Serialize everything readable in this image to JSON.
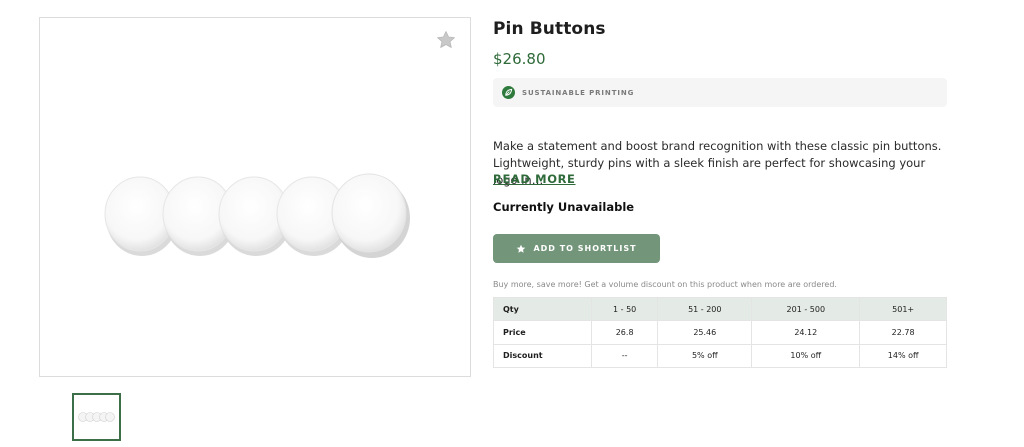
{
  "product": {
    "title": "Pin Buttons",
    "price": "$26.80",
    "badge": "SUSTAINABLE PRINTING",
    "description": "Make a statement and boost brand recognition with these classic pin buttons. Lightweight, sturdy pins with a sleek finish are perfect for showcasing your logo in…",
    "read_more": "READ MORE",
    "availability": "Currently Unavailable",
    "shortlist_button": "ADD TO SHORTLIST",
    "volume_note": "Buy more, save more! Get a volume discount on this product when more are ordered."
  },
  "icons": {
    "favorite": "star-icon",
    "badge": "leaf-icon",
    "button": "star-icon"
  },
  "colors": {
    "accent": "#2e6a3a",
    "button_bg": "#73967a",
    "table_header_bg": "#e4eae5"
  },
  "volume_table": {
    "header": [
      "Qty",
      "1 - 50",
      "51 - 200",
      "201 - 500",
      "501+"
    ],
    "rows": [
      [
        "Price",
        "26.8",
        "25.46",
        "24.12",
        "22.78"
      ],
      [
        "Discount",
        "--",
        "5% off",
        "10% off",
        "14% off"
      ]
    ]
  }
}
